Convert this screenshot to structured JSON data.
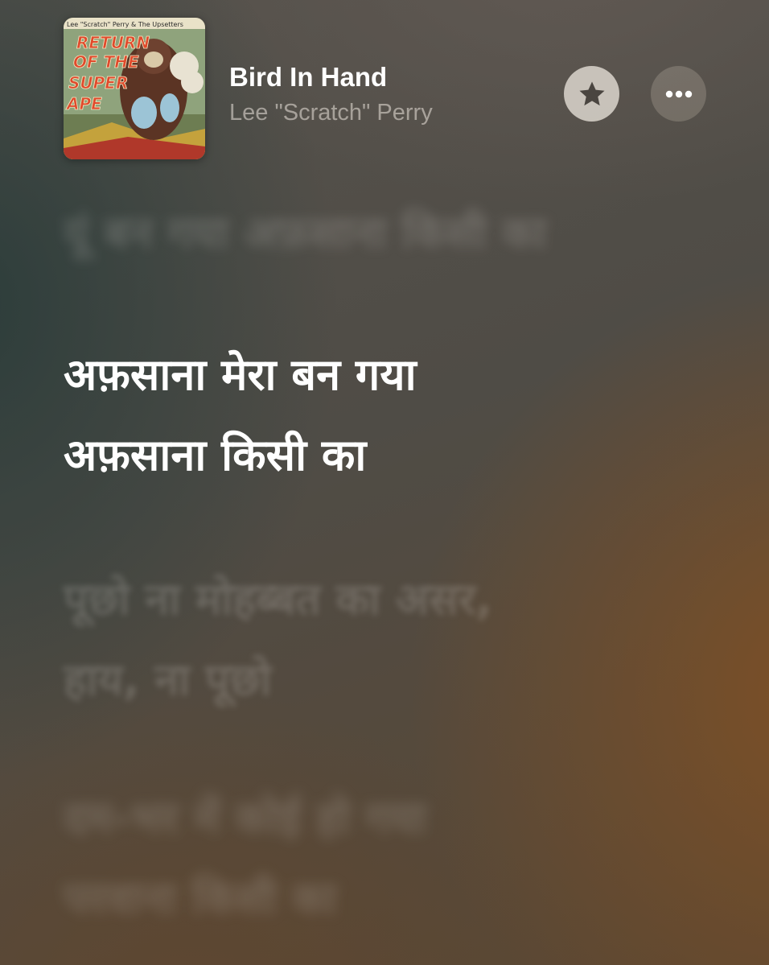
{
  "now_playing": {
    "album_art": {
      "credit": "Lee \"Scratch\" Perry & The Upsetters",
      "title_lines": [
        "RETURN",
        "OF THE",
        "SUPER",
        "APE"
      ]
    },
    "title": "Bird In Hand",
    "artist": "Lee \"Scratch\" Perry",
    "favorite_icon": "star-icon",
    "more_icon": "ellipsis-icon"
  },
  "lyrics": {
    "previous": {
      "lines": [
        "यूं बन गया अफ़साना किसी का"
      ]
    },
    "current": {
      "lines": [
        "अफ़साना मेरा बन गया",
        "अफ़साना किसी का"
      ]
    },
    "upcoming": [
      {
        "lines": [
          "पूछो ना मोहब्बत का असर,",
          "हाय, ना पूछो"
        ]
      },
      {
        "lines": [
          "दम-भर में कोई हो गया",
          "परवाना किसी का"
        ]
      }
    ]
  },
  "colors": {
    "background": "#4e4a44",
    "active_lyric": "#ffffff",
    "inactive_lyric": "#dcd7d2",
    "star_button": "#e1dad2"
  }
}
